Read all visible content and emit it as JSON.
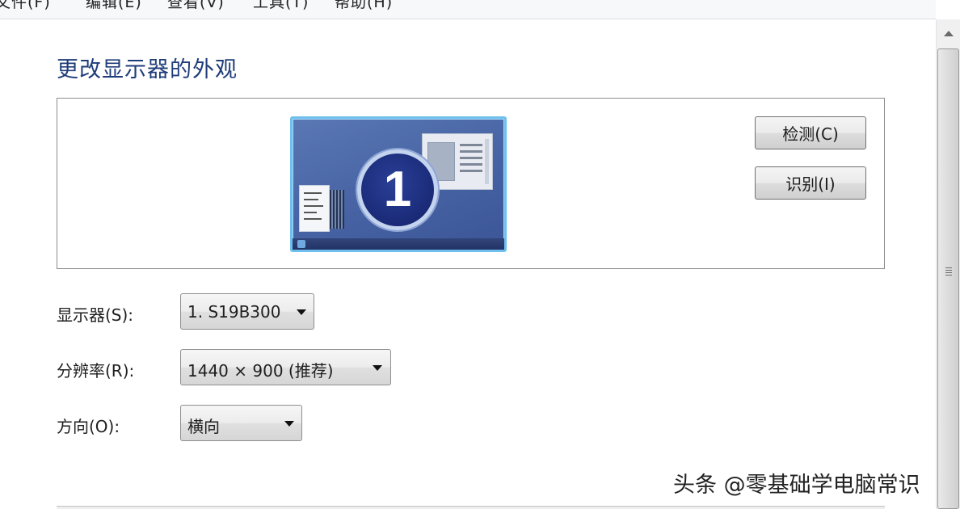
{
  "menu": {
    "items": [
      {
        "label": "文件(F)"
      },
      {
        "label": "编辑(E)"
      },
      {
        "label": "查看(V)"
      },
      {
        "label": "工具(T)"
      },
      {
        "label": "帮助(H)"
      }
    ]
  },
  "page": {
    "title": "更改显示器的外观"
  },
  "preview": {
    "monitor_number": "1",
    "detect_button": "检测(C)",
    "identify_button": "识别(I)"
  },
  "form": {
    "display": {
      "label": "显示器(S):",
      "value": "1. S19B300"
    },
    "resolution": {
      "label": "分辨率(R):",
      "value": "1440 × 900 (推荐)"
    },
    "orientation": {
      "label": "方向(O):",
      "value": "横向"
    }
  },
  "watermark": {
    "text": "头条 @零基础学电脑常识"
  },
  "icons": {
    "dropdown": "chevron-down-icon",
    "scroll_up": "scroll-up-arrow-icon"
  }
}
